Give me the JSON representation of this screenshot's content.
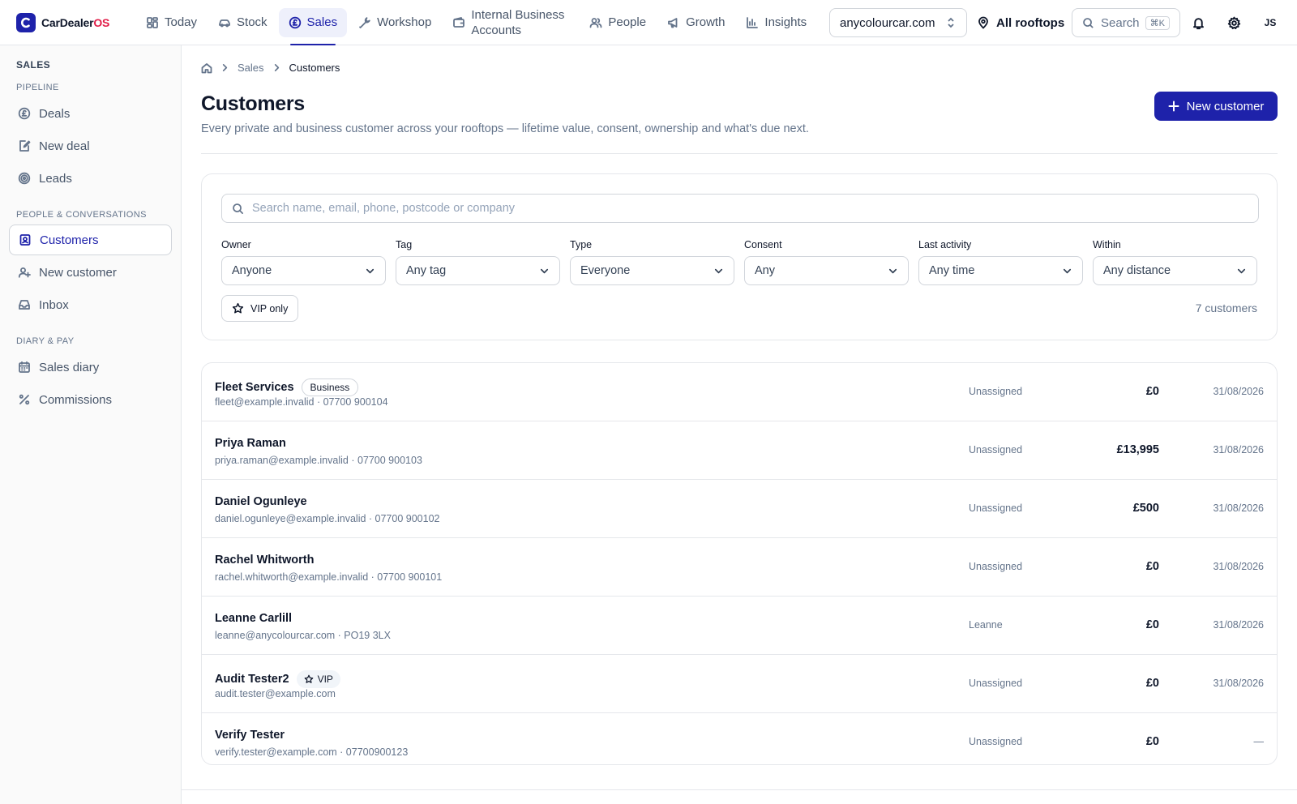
{
  "brand": {
    "name": "CarDealer",
    "suffix": "OS",
    "color": "#1e22aa"
  },
  "nav": {
    "tabs": [
      {
        "label": "Today",
        "icon": "dashboard-icon"
      },
      {
        "label": "Stock",
        "icon": "car-icon"
      },
      {
        "label": "Sales",
        "icon": "pound-circle-icon",
        "active": true
      },
      {
        "label": "Workshop",
        "icon": "wrench-icon"
      },
      {
        "label": "Internal Business Accounts",
        "icon": "wallet-icon"
      },
      {
        "label": "People",
        "icon": "users-icon"
      },
      {
        "label": "Growth",
        "icon": "megaphone-icon"
      },
      {
        "label": "Insights",
        "icon": "bar-chart-icon"
      }
    ],
    "domain": "anycolourcar.com",
    "rooftops": "All rooftops",
    "search_label": "Search",
    "search_shortcut": "⌘K",
    "avatar_initials": "JS"
  },
  "sidebar": {
    "heading": "SALES",
    "groups": [
      {
        "label": "PIPELINE",
        "items": [
          {
            "label": "Deals",
            "icon": "pound-circle-icon"
          },
          {
            "label": "New deal",
            "icon": "edit-document-icon"
          },
          {
            "label": "Leads",
            "icon": "target-icon"
          }
        ]
      },
      {
        "label": "PEOPLE & CONVERSATIONS",
        "items": [
          {
            "label": "Customers",
            "icon": "contact-card-icon",
            "active": true
          },
          {
            "label": "New customer",
            "icon": "user-plus-icon"
          },
          {
            "label": "Inbox",
            "icon": "inbox-icon"
          }
        ]
      },
      {
        "label": "DIARY & PAY",
        "items": [
          {
            "label": "Sales diary",
            "icon": "calendar-icon"
          },
          {
            "label": "Commissions",
            "icon": "percent-icon"
          }
        ]
      }
    ]
  },
  "breadcrumb": {
    "items": [
      "Sales",
      "Customers"
    ]
  },
  "page": {
    "title": "Customers",
    "subtitle": "Every private and business customer across your rooftops — lifetime value, consent, ownership and what's due next.",
    "new_button": "New customer"
  },
  "filters": {
    "search_placeholder": "Search name, email, phone, postcode or company",
    "fields": [
      {
        "label": "Owner",
        "value": "Anyone"
      },
      {
        "label": "Tag",
        "value": "Any tag"
      },
      {
        "label": "Type",
        "value": "Everyone"
      },
      {
        "label": "Consent",
        "value": "Any"
      },
      {
        "label": "Last activity",
        "value": "Any time"
      },
      {
        "label": "Within",
        "value": "Any distance"
      }
    ],
    "vip_label": "VIP only",
    "count_text": "7 customers"
  },
  "customers": [
    {
      "name": "Fleet Services",
      "badge": "Business",
      "contact": "fleet@example.invalid · 07700 900104",
      "owner": "Unassigned",
      "value": "£0",
      "date": "31/08/2026"
    },
    {
      "name": "Priya Raman",
      "badge": "",
      "contact": "priya.raman@example.invalid · 07700 900103",
      "owner": "Unassigned",
      "value": "£13,995",
      "date": "31/08/2026"
    },
    {
      "name": "Daniel Ogunleye",
      "badge": "",
      "contact": "daniel.ogunleye@example.invalid · 07700 900102",
      "owner": "Unassigned",
      "value": "£500",
      "date": "31/08/2026"
    },
    {
      "name": "Rachel Whitworth",
      "badge": "",
      "contact": "rachel.whitworth@example.invalid · 07700 900101",
      "owner": "Unassigned",
      "value": "£0",
      "date": "31/08/2026"
    },
    {
      "name": "Leanne Carlill",
      "badge": "",
      "contact": "leanne@anycolourcar.com · PO19 3LX",
      "owner": "Leanne",
      "value": "£0",
      "date": "31/08/2026"
    },
    {
      "name": "Audit Tester2",
      "badge": "VIP",
      "contact": "audit.tester@example.com",
      "owner": "Unassigned",
      "value": "£0",
      "date": "31/08/2026"
    },
    {
      "name": "Verify Tester",
      "badge": "",
      "contact": "verify.tester@example.com · 07700900123",
      "owner": "Unassigned",
      "value": "£0",
      "date": "—"
    }
  ]
}
